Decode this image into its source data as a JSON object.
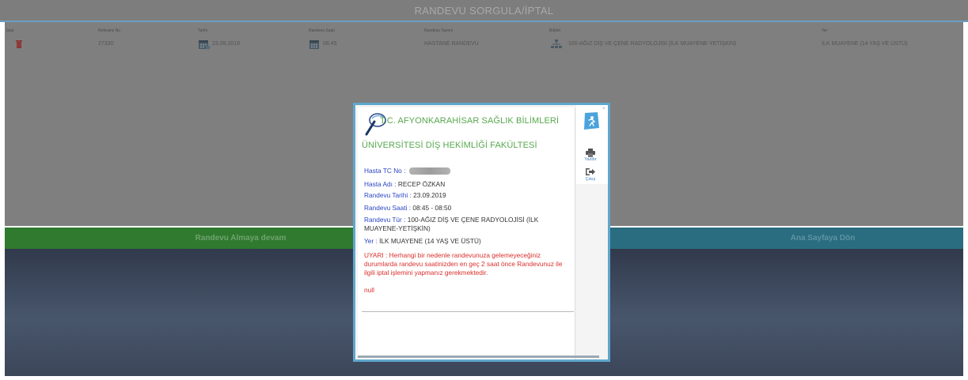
{
  "page": {
    "title": "RANDEVU SORGULA/İPTAL"
  },
  "table": {
    "headers": [
      "İptal",
      "Referans No",
      "Tarihi",
      "Randevu Saati",
      "Randevu Tanımı",
      "Bölüm",
      "Yer"
    ],
    "row": {
      "referans_no": "27330",
      "tarih": "23.09.2019",
      "saat": "08:45",
      "tanim": "HASTANE RANDEVU",
      "bolum": "100-AĞIZ DİŞ VE ÇENE RADYOLOJİSİ (İLK MUAYENE-YETİŞKİN)",
      "yer": "İLK MUAYENE (14 YAŞ VE ÜSTÜ)"
    }
  },
  "actions": {
    "continue_label": "Randevu Almaya devam",
    "home_label": "Ana Sayfaya Dön"
  },
  "modal": {
    "org_line1": "T.C. AFYONKARAHİSAR SAĞLIK BİLİMLERİ",
    "org_line2": "ÜNİVERSİTESİ DİŞ HEKİMLİĞİ FAKÜLTESİ",
    "tc_label": "Hasta TC No : ",
    "name_label": "Hasta Adı : ",
    "name_value": "RECEP ÖZKAN",
    "date_label": "Randevu Tarihi : ",
    "date_value": "23.09.2019",
    "time_label": "Randevu Saati : ",
    "time_value": "08:45 - 08:50",
    "type_label": "Randevu Tür : ",
    "type_value": "100-AĞIZ DİŞ VE ÇENE RADYOLOJİSİ (İLK MUAYENE-YETİŞKİN)",
    "place_label": "Yer : ",
    "place_value": "İLK MUAYENE (14 YAŞ VE ÜSTÜ)",
    "warning_label": "UYARI : ",
    "warning_text": "Herhangi bir nedenle randevunuza gelemeyeceğiniz durumlarda randevu saatinizden en geç 2 saat önce Randevunuz ile ilgili iptal işlemini yapmanız gerekmektedir.",
    "extra": "null",
    "print_label": "Yazdır",
    "exit_label": "Çıkış",
    "close_label": "×"
  },
  "colors": {
    "org_green": "#57a84e",
    "label_blue": "#2b46c2",
    "warning_red": "#d9302c",
    "modal_border": "#5fa6cc"
  },
  "icons": {
    "delete": "trash-icon",
    "calendar": "calendar-icon",
    "department": "hierarchy-icon",
    "logo": "tooth-logo-icon",
    "print": "printer-icon",
    "exit": "sign-out-icon"
  }
}
